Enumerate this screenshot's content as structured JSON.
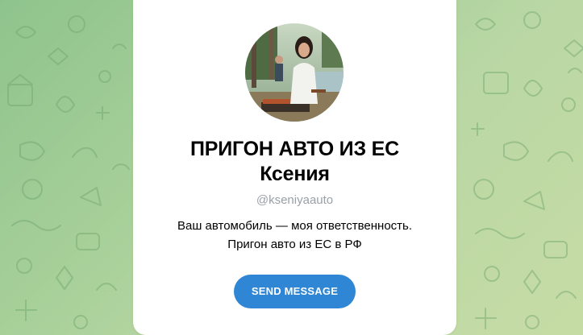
{
  "channel": {
    "title_line1": "ПРИГОН АВТО ИЗ ЕС",
    "title_line2": "Ксения",
    "username": "@kseniyaauto",
    "description_line1": "Ваш автомобиль — моя ответственность.",
    "description_line2": "Пригон авто из ЕС в РФ"
  },
  "actions": {
    "send_message_label": "SEND MESSAGE"
  },
  "colors": {
    "button": "#2f86d4",
    "username": "#9aa0a6",
    "background": "#a6cf98"
  }
}
